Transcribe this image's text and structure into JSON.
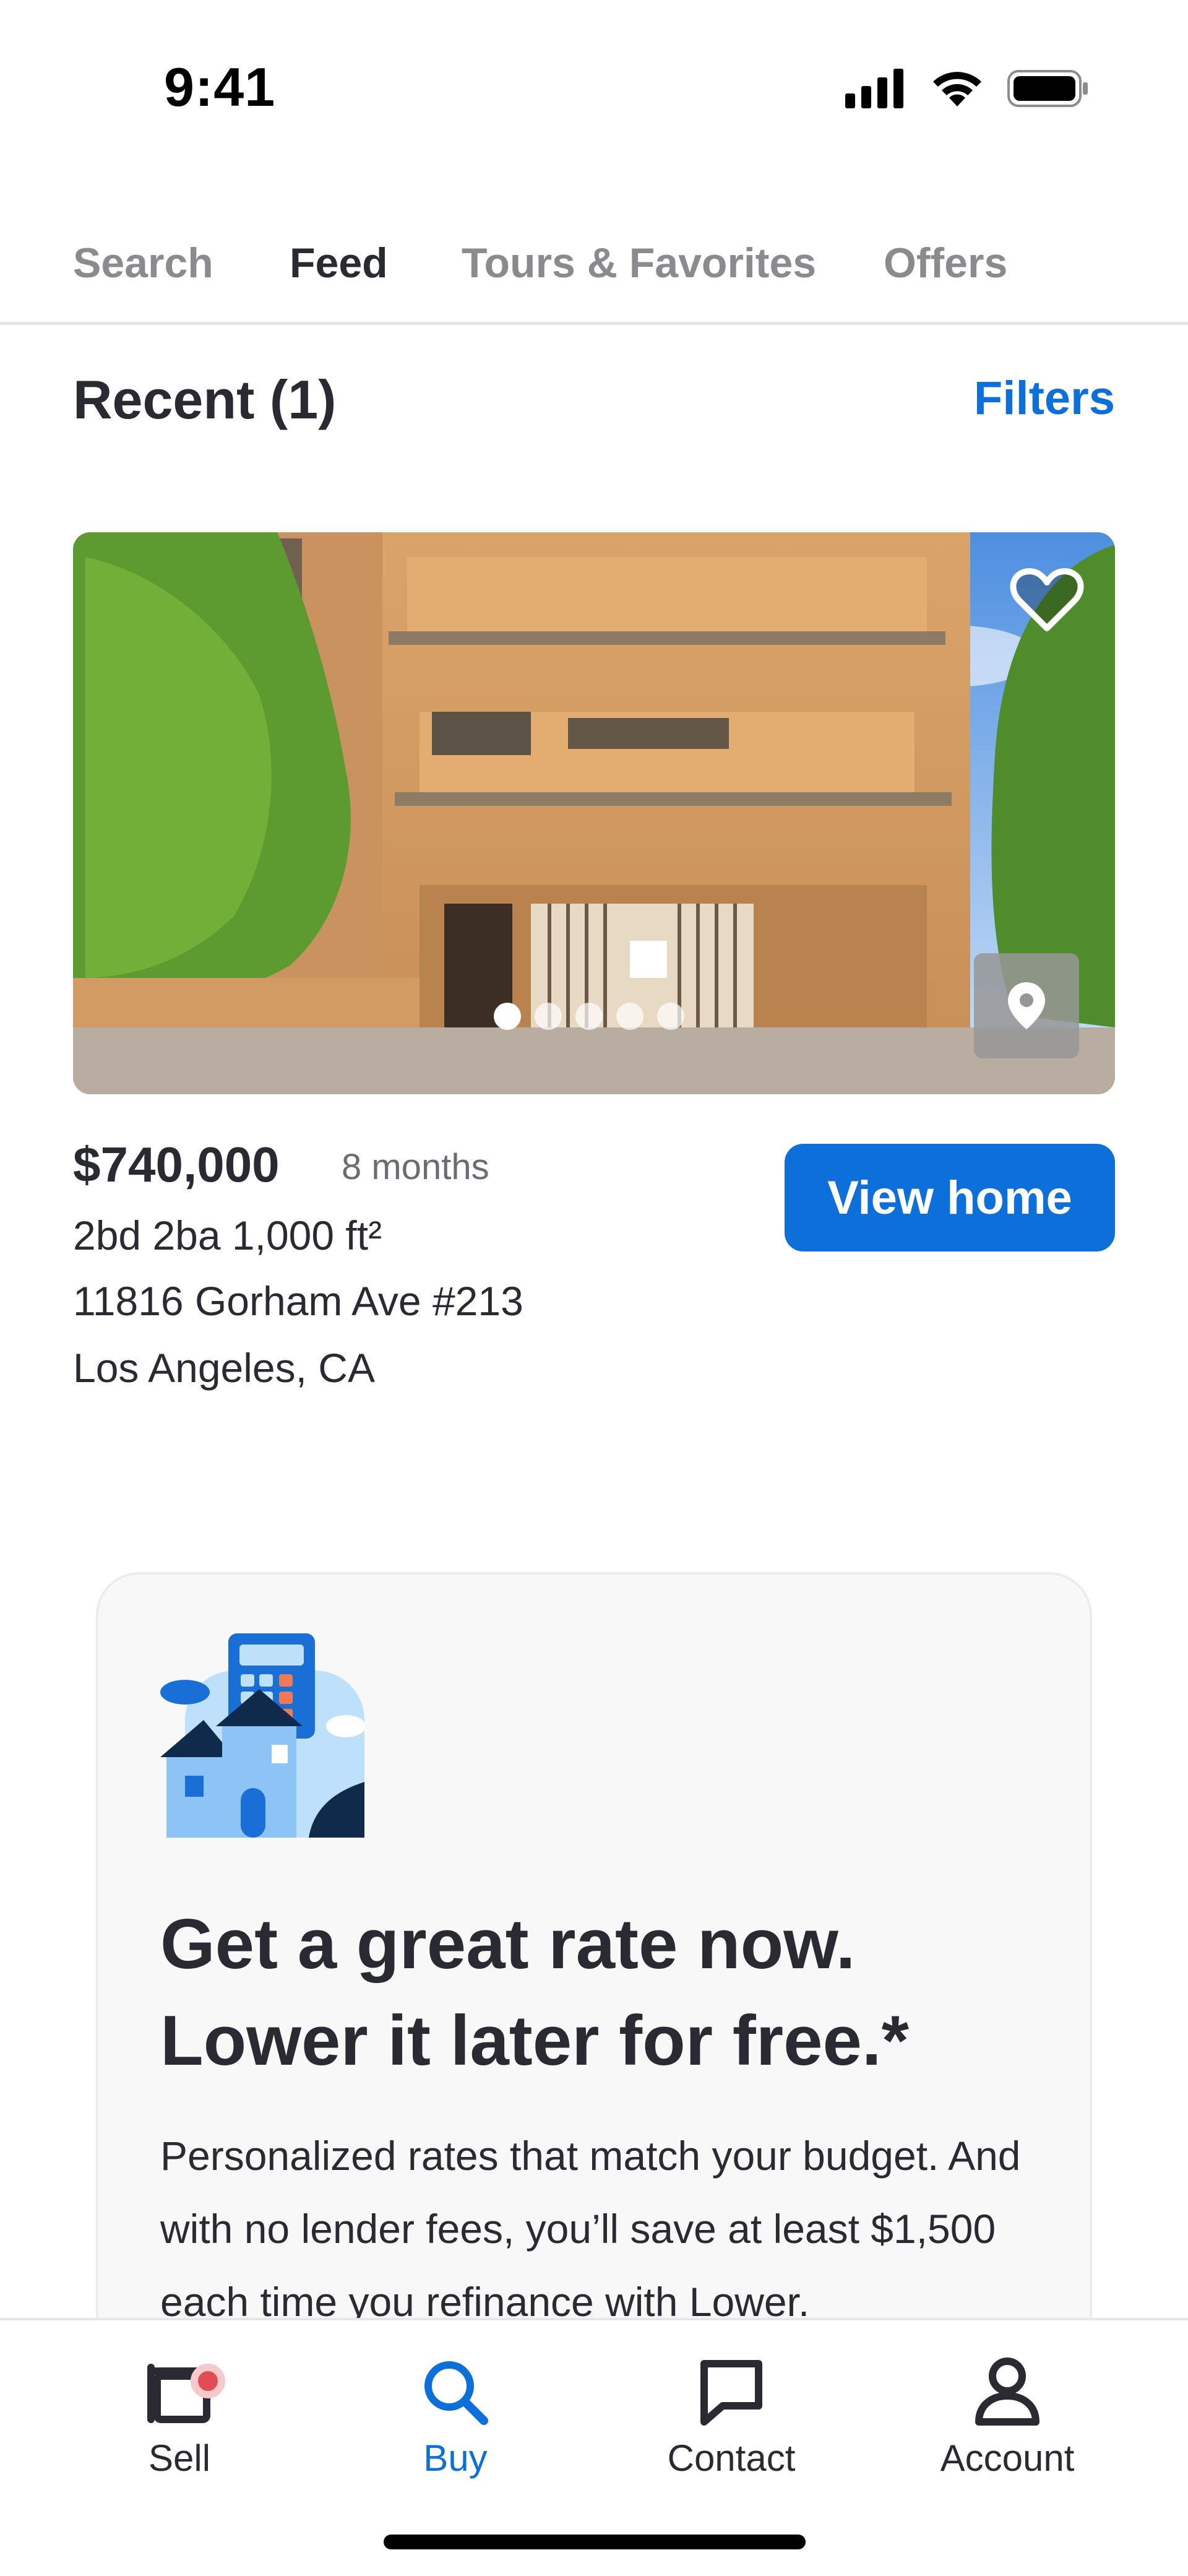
{
  "status_bar": {
    "time": "9:41"
  },
  "tabs": [
    {
      "label": "Search",
      "active": false
    },
    {
      "label": "Feed",
      "active": true
    },
    {
      "label": "Tours & Favorites",
      "active": false
    },
    {
      "label": "Offers",
      "active": false
    }
  ],
  "recent": {
    "title": "Recent (1)",
    "filters_label": "Filters"
  },
  "listing": {
    "price": "$740,000",
    "age": "8 months",
    "facts": "2bd  2ba  1,000 ft²",
    "address_line1": "11816 Gorham Ave #213",
    "address_line2": "Los Angeles, CA",
    "view_button_label": "View home",
    "photo_count": 5,
    "active_photo_index": 0
  },
  "promo": {
    "headline": "Get a great rate now. Lower it later for free.*",
    "body": "Personalized rates that match your budget. And with no lender fees, you’ll save at least $1,500 each time you refinance with Lower."
  },
  "bottom_nav": [
    {
      "label": "Sell",
      "icon": "sell-icon",
      "active": false,
      "badge": true
    },
    {
      "label": "Buy",
      "icon": "search-icon",
      "active": true
    },
    {
      "label": "Contact",
      "icon": "chat-bubble-icon",
      "active": false
    },
    {
      "label": "Account",
      "icon": "person-icon",
      "active": false
    }
  ],
  "colors": {
    "accent": "#0d6fd9",
    "text": "#2a2a33",
    "muted": "#8a8a8f",
    "badge": "#e04d53"
  }
}
